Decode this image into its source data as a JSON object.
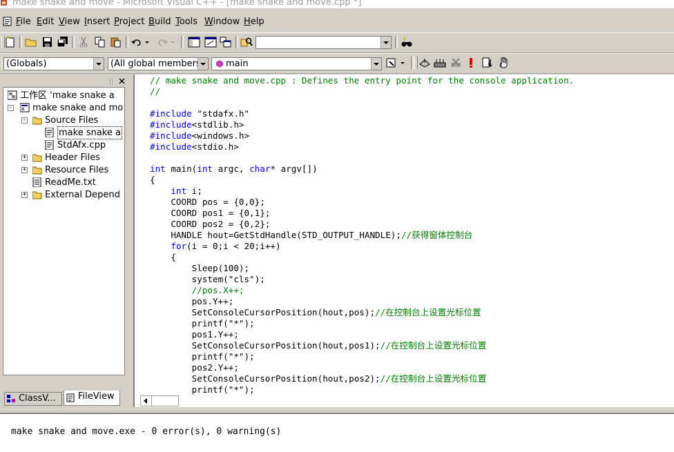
{
  "window": {
    "title": "make snake and move - Microsoft Visual C++ - [make snake and move.cpp *]"
  },
  "menu": [
    "File",
    "Edit",
    "View",
    "Insert",
    "Project",
    "Build",
    "Tools",
    "Window",
    "Help"
  ],
  "menu_mnemonics": [
    "F",
    "E",
    "V",
    "I",
    "P",
    "B",
    "T",
    "W",
    "H"
  ],
  "toolbar": {
    "find_combo_value": "",
    "class_combo": "(Globals)",
    "members_combo": "(All global members",
    "function_combo": "main"
  },
  "workspace": {
    "tree": [
      {
        "label": "工作区 'make snake a",
        "level": 0,
        "expander": "",
        "icon": "workspace-icon"
      },
      {
        "label": "make snake and mo",
        "level": 0,
        "expander": "-",
        "icon": "project-icon"
      },
      {
        "label": "Source Files",
        "level": 1,
        "expander": "-",
        "icon": "folder-open-icon"
      },
      {
        "label": "make snake a",
        "level": 2,
        "expander": "",
        "icon": "cpp-file-icon"
      },
      {
        "label": "StdAfx.cpp",
        "level": 2,
        "expander": "",
        "icon": "cpp-file-icon"
      },
      {
        "label": "Header Files",
        "level": 1,
        "expander": "+",
        "icon": "folder-icon"
      },
      {
        "label": "Resource Files",
        "level": 1,
        "expander": "+",
        "icon": "folder-icon"
      },
      {
        "label": "ReadMe.txt",
        "level": 1,
        "expander": "",
        "icon": "text-file-icon"
      },
      {
        "label": "External Depend",
        "level": 1,
        "expander": "+",
        "icon": "folder-icon"
      }
    ],
    "tabs": [
      "ClassV...",
      "FileView"
    ]
  },
  "editor": {
    "lines": [
      "// make snake and move.cpp : Defines the entry point for the console application.",
      "//",
      "",
      "#include \"stdafx.h\"",
      "#include<stdlib.h>",
      "#include<windows.h>",
      "#include<stdio.h>",
      "",
      "int main(int argc, char* argv[])",
      "{",
      "    int i;",
      "    COORD pos = {0,0};",
      "    COORD pos1 = {0,1};",
      "    COORD pos2 = {0,2};",
      "    HANDLE hout=GetStdHandle(STD_OUTPUT_HANDLE);//获得窗体控制台",
      "    for(i = 0;i < 20;i++)",
      "    {",
      "        Sleep(100);",
      "        system(\"cls\");",
      "        //pos.X++;",
      "        pos.Y++;",
      "        SetConsoleCursorPosition(hout,pos);//在控制台上设置光标位置",
      "        printf(\"*\");",
      "        pos1.Y++;",
      "        SetConsoleCursorPosition(hout,pos1);//在控制台上设置光标位置",
      "        printf(\"*\");",
      "        pos2.Y++;",
      "        SetConsoleCursorPosition(hout,pos2);//在控制台上设置光标位置",
      "        printf(\"*\");"
    ]
  },
  "output": {
    "text": "make snake and move.exe - 0 error(s), 0 warning(s)"
  },
  "colors": {
    "keyword": "#0000ff",
    "comment": "#008000",
    "background": "#d4d0c8"
  }
}
